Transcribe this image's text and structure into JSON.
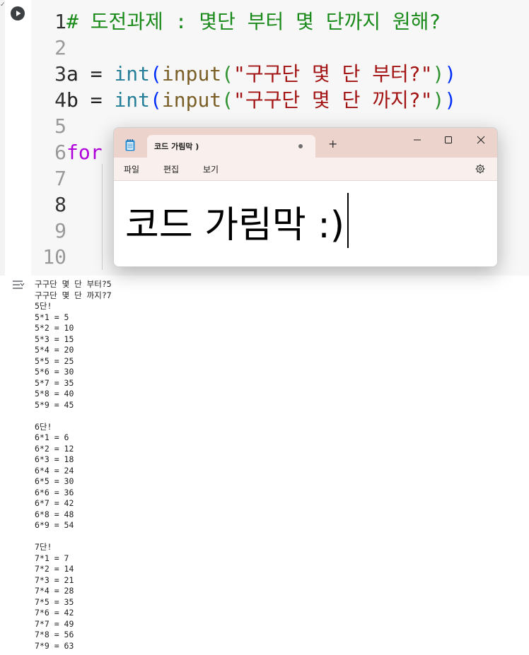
{
  "gutter": {
    "check_mark": "✓"
  },
  "editor": {
    "lines": [
      {
        "num": "1",
        "active": true,
        "tokens": [
          {
            "c": "t-comment",
            "t": "# 도전과제 : 몇단 부터 몇 단까지 원해?"
          }
        ]
      },
      {
        "num": "2",
        "active": false,
        "tokens": []
      },
      {
        "num": "3",
        "active": true,
        "tokens": [
          {
            "c": "t-var",
            "t": "a"
          },
          {
            "c": "t-var",
            "t": " = "
          },
          {
            "c": "t-builtin",
            "t": "int"
          },
          {
            "c": "t-paren1",
            "t": "("
          },
          {
            "c": "t-fn",
            "t": "input"
          },
          {
            "c": "t-paren2",
            "t": "("
          },
          {
            "c": "t-str",
            "t": "\"구구단 몇 단 부터?\""
          },
          {
            "c": "t-paren2",
            "t": ")"
          },
          {
            "c": "t-paren1",
            "t": ")"
          }
        ]
      },
      {
        "num": "4",
        "active": true,
        "tokens": [
          {
            "c": "t-var",
            "t": "b"
          },
          {
            "c": "t-var",
            "t": " = "
          },
          {
            "c": "t-builtin",
            "t": "int"
          },
          {
            "c": "t-paren1",
            "t": "("
          },
          {
            "c": "t-fn",
            "t": "input"
          },
          {
            "c": "t-paren2",
            "t": "("
          },
          {
            "c": "t-str",
            "t": "\"구구단 몇 단 까지?\""
          },
          {
            "c": "t-paren2",
            "t": ")"
          },
          {
            "c": "t-paren1",
            "t": ")"
          }
        ]
      },
      {
        "num": "5",
        "active": false,
        "tokens": []
      },
      {
        "num": "6",
        "active": false,
        "tokens": [
          {
            "c": "t-kw",
            "t": "for"
          }
        ]
      },
      {
        "num": "7",
        "active": false,
        "tokens": []
      },
      {
        "num": "8",
        "active": true,
        "tokens": []
      },
      {
        "num": "9",
        "active": false,
        "tokens": []
      },
      {
        "num": "10",
        "active": false,
        "tokens": []
      }
    ]
  },
  "output": {
    "text": "구구단 몇 단 부터?5\n구구단 몇 단 까지?7\n5단!\n5*1 = 5\n5*2 = 10\n5*3 = 15\n5*4 = 20\n5*5 = 25\n5*6 = 30\n5*7 = 35\n5*8 = 40\n5*9 = 45\n\n6단!\n6*1 = 6\n6*2 = 12\n6*3 = 18\n6*4 = 24\n6*5 = 30\n6*6 = 36\n6*7 = 42\n6*8 = 48\n6*9 = 54\n\n7단!\n7*1 = 7\n7*2 = 14\n7*3 = 21\n7*4 = 28\n7*5 = 35\n7*6 = 42\n7*7 = 49\n7*8 = 56\n7*9 = 63"
  },
  "notepad": {
    "tab_title": "코드 가림막 )",
    "new_tab": "+",
    "menu": {
      "file": "파일",
      "edit": "편집",
      "view": "보기"
    },
    "content": "코드 가림막 :)"
  },
  "colors": {
    "titlebar": "#ecd3cc",
    "string": "#a31515",
    "keyword": "#af00db",
    "comment": "#1a8a1a",
    "builtin": "#267f99"
  },
  "icons": {
    "run": "play-circle-icon",
    "output": "output-toggle-icon",
    "app": "notepad-icon",
    "settings": "gear-icon"
  }
}
